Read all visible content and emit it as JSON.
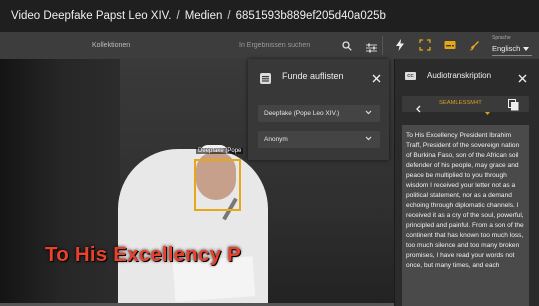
{
  "breadcrumb": {
    "item1": "Video Deepfake Papst Leo XIV.",
    "item2": "Medien",
    "item3": "6851593b889ef205d40a025b",
    "separator": "/"
  },
  "toolbar": {
    "collections_label": "Kollektionen",
    "search_placeholder": "In Ergebnissen suchen",
    "language_label": "Sprache",
    "language_value": "Englisch"
  },
  "video": {
    "face_label": "Deepfake (Pope",
    "caption": "To His Excellency P"
  },
  "funde_panel": {
    "title": "Funde auflisten",
    "select_1": "Deepfake (Pope Leo XIV.)",
    "select_2": "Anonym"
  },
  "audio_panel": {
    "title": "Audiotranskription",
    "segment_label": "SEAMLESSM4T",
    "transcript": "To His Excellency President Ibrahim Traff, President of the sovereign nation of Burkina Faso, son of the African soil defender of his people, may grace and peace be multiplied to you through wisdom I received your letter not as a political statement, nor as a demand echoing through diplomatic channels. I received it as a cry of the soul, powerful, principled and painful. From a son of the continent that has known too much loss, too much silence and too many broken promises, I have read your words not once, but many times, and each"
  },
  "colors": {
    "accent_orange": "#e6a817",
    "caption_red": "#e8422e",
    "segment_gold": "#d4a020"
  },
  "icons": [
    "search-icon",
    "filter-icon",
    "flash-icon",
    "crop-icon",
    "subtitles-icon",
    "brush-icon",
    "chevron-down-icon",
    "list-icon",
    "close-icon",
    "cc-icon",
    "chevron-left-icon",
    "copy-icon"
  ]
}
